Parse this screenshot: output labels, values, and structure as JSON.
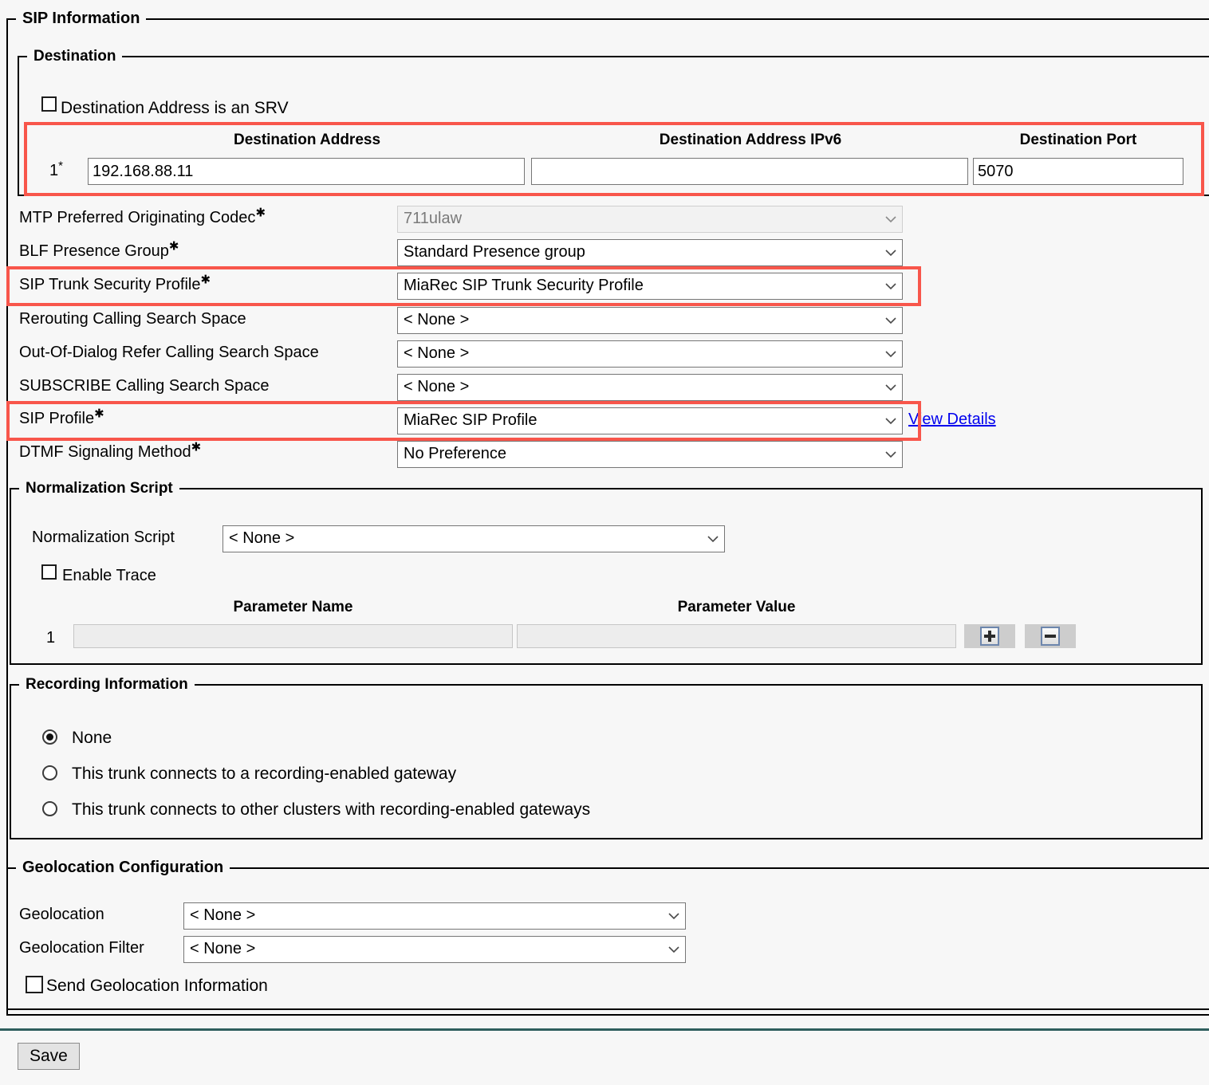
{
  "sip_information": {
    "legend": "SIP Information",
    "destination": {
      "legend": "Destination",
      "srv_checkbox_label": "Destination Address is an SRV",
      "srv_checked": false,
      "columns": [
        "Destination Address",
        "Destination Address IPv6",
        "Destination Port"
      ],
      "rows": [
        {
          "index": "1",
          "required_marker": "*",
          "address": "192.168.88.11",
          "address_ipv6": "",
          "port": "5070"
        }
      ]
    },
    "fields": [
      {
        "label": "MTP Preferred Originating Codec",
        "required": true,
        "control": "select",
        "value": "711ulaw",
        "disabled": true,
        "highlighted": false
      },
      {
        "label": "BLF Presence Group",
        "required": true,
        "control": "select",
        "value": "Standard Presence group",
        "disabled": false,
        "highlighted": false
      },
      {
        "label": "SIP Trunk Security Profile",
        "required": true,
        "control": "select",
        "value": "MiaRec SIP Trunk Security Profile",
        "disabled": false,
        "highlighted": true
      },
      {
        "label": "Rerouting Calling Search Space",
        "required": false,
        "control": "select",
        "value": "< None >",
        "disabled": false,
        "highlighted": false
      },
      {
        "label": "Out-Of-Dialog Refer Calling Search Space",
        "required": false,
        "control": "select",
        "value": "< None >",
        "disabled": false,
        "highlighted": false
      },
      {
        "label": "SUBSCRIBE Calling Search Space",
        "required": false,
        "control": "select",
        "value": "< None >",
        "disabled": false,
        "highlighted": false
      },
      {
        "label": "SIP Profile",
        "required": true,
        "control": "select",
        "value": "MiaRec SIP Profile",
        "disabled": false,
        "highlighted": true,
        "link": "View Details"
      },
      {
        "label": "DTMF Signaling Method",
        "required": true,
        "control": "select",
        "value": "No Preference",
        "disabled": false,
        "highlighted": false
      }
    ],
    "normalization_script": {
      "legend": "Normalization Script",
      "script_label": "Normalization Script",
      "script_value": "< None >",
      "enable_trace_label": "Enable Trace",
      "enable_trace_checked": false,
      "columns": [
        "Parameter Name",
        "Parameter Value"
      ],
      "rows": [
        {
          "index": "1",
          "name": "",
          "value": ""
        }
      ],
      "add_button": "+",
      "remove_button": "-"
    },
    "recording_information": {
      "legend": "Recording Information",
      "options": [
        {
          "label": "None",
          "selected": true
        },
        {
          "label": "This trunk connects to a recording-enabled gateway",
          "selected": false
        },
        {
          "label": "This trunk connects to other clusters with recording-enabled gateways",
          "selected": false
        }
      ]
    }
  },
  "geolocation_configuration": {
    "legend": "Geolocation Configuration",
    "geolocation_label": "Geolocation",
    "geolocation_value": "< None >",
    "geolocation_filter_label": "Geolocation Filter",
    "geolocation_filter_value": "< None >",
    "send_geolocation_label": "Send Geolocation Information",
    "send_geolocation_checked": false
  },
  "footer": {
    "save_label": "Save"
  },
  "colors": {
    "highlight": "#f8564b",
    "link": "#0000ee",
    "separator": "#2f5f5e",
    "page_bg": "#f7f7f7"
  }
}
